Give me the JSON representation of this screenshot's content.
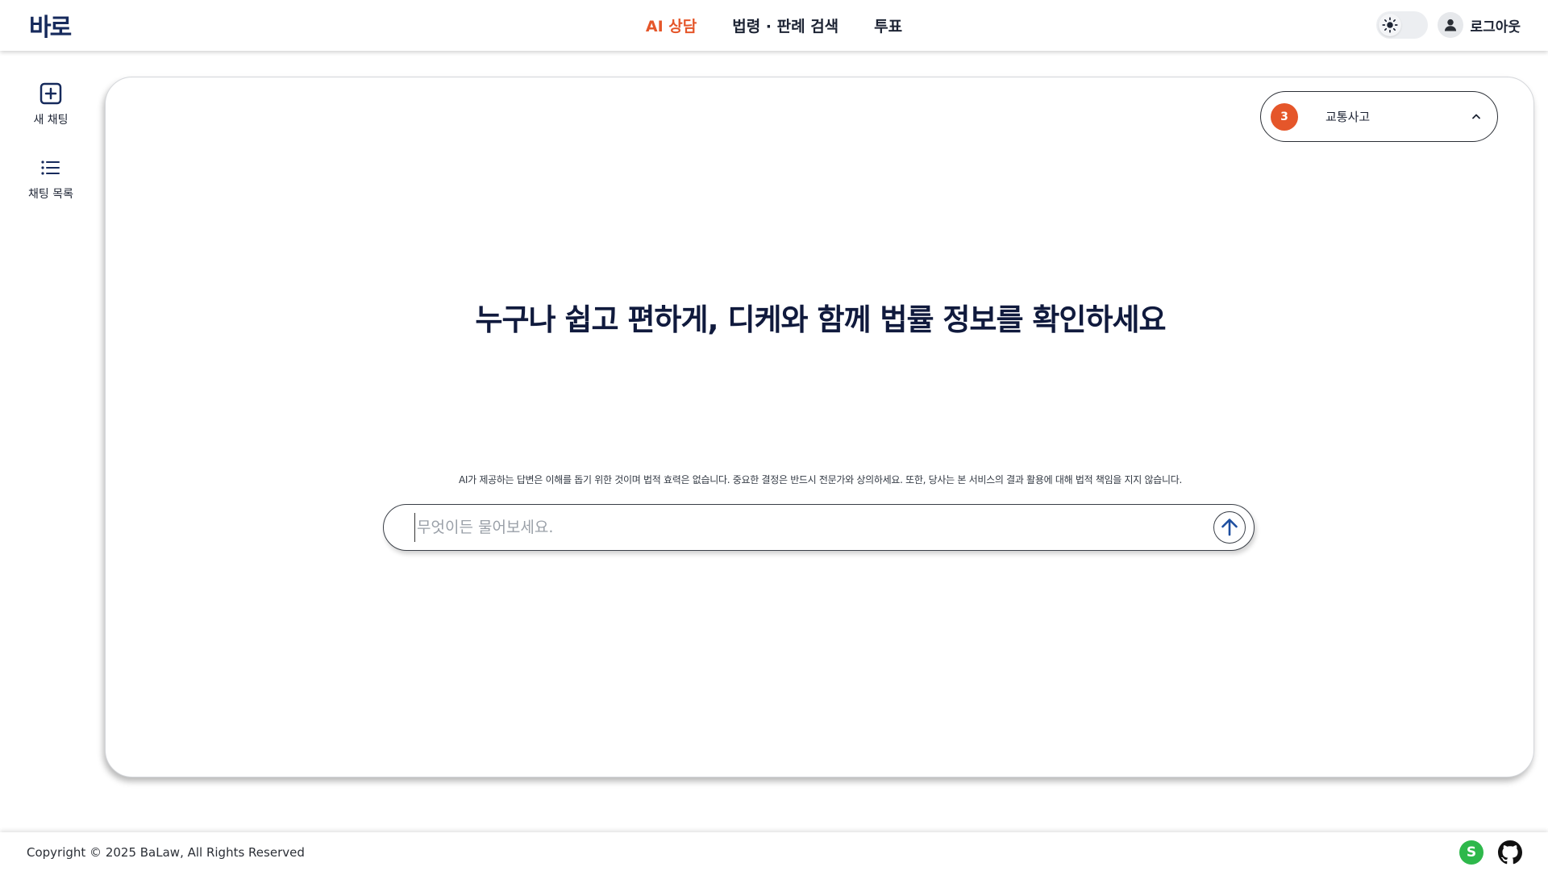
{
  "brand": {
    "logo_text": "바로"
  },
  "nav": [
    {
      "label": "AI 상담",
      "active": true
    },
    {
      "label": "법령 · 판례 검색",
      "active": false
    },
    {
      "label": "투표",
      "active": false
    }
  ],
  "header": {
    "theme_icon": "sun-icon",
    "logout_label": "로그아웃"
  },
  "sidebar": {
    "items": [
      {
        "label": "새 채팅",
        "icon": "plus-square-icon"
      },
      {
        "label": "채팅 목록",
        "icon": "list-icon"
      }
    ]
  },
  "category": {
    "count": "3",
    "label": "교통사고"
  },
  "main": {
    "headline": "누구나 쉽고 편하게, 디케와 함께 법률 정보를 확인하세요",
    "disclaimer": "AI가 제공하는 답변은 이해를 돕기 위한 것이며 법적 효력은 없습니다. 중요한 결정은 반드시 전문가와 상의하세요. 또한, 당사는 본 서비스의 결과 활용에 대해 법적 책임을 지지 않습니다.",
    "input_placeholder": "무엇이든 물어보세요."
  },
  "footer": {
    "copyright": "Copyright © 2025 BaLaw, All Rights Reserved",
    "s_badge": "S"
  },
  "colors": {
    "accent": "#e5562a",
    "navy": "#162a5c",
    "green": "#2eb84b"
  }
}
